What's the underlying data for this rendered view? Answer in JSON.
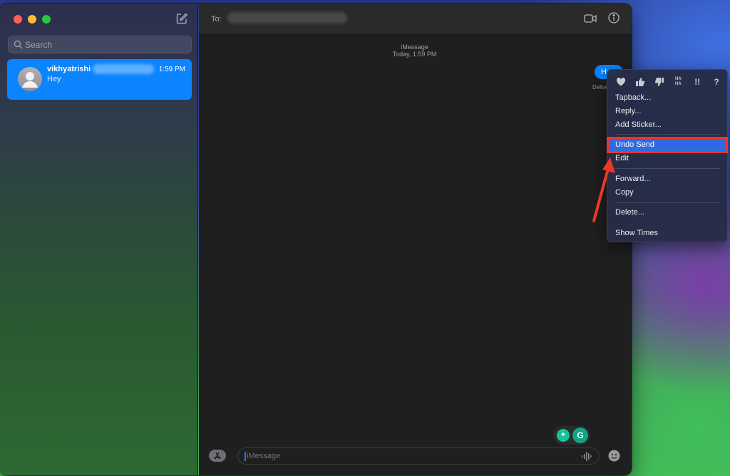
{
  "sidebar": {
    "search_placeholder": "Search",
    "conversations": [
      {
        "name": "vikhyatrishi",
        "time": "1:59 PM",
        "preview": "Hey"
      }
    ]
  },
  "chat": {
    "to_label": "To:",
    "service": "iMessage",
    "timestamp": "Today, 1:59 PM",
    "message_text": "Hey",
    "delivered_text": "Delivered",
    "compose_placeholder": "iMessage"
  },
  "context_menu": {
    "tapbacks": [
      "heart-icon",
      "thumbs-up-icon",
      "thumbs-down-icon",
      "haha-icon",
      "exclamation-icon",
      "question-icon"
    ],
    "tapback_haha": "HA HA",
    "tapback_emphasis": "!!",
    "tapback_question": "?",
    "items": [
      "Tapback...",
      "Reply...",
      "Add Sticker...",
      "Undo Send",
      "Edit",
      "Forward...",
      "Copy",
      "Delete...",
      "Show Times"
    ],
    "highlighted": "Undo Send"
  },
  "colors": {
    "accent": "#0a84ff",
    "highlight": "#2f6ae1",
    "annotation": "#e8382a"
  }
}
